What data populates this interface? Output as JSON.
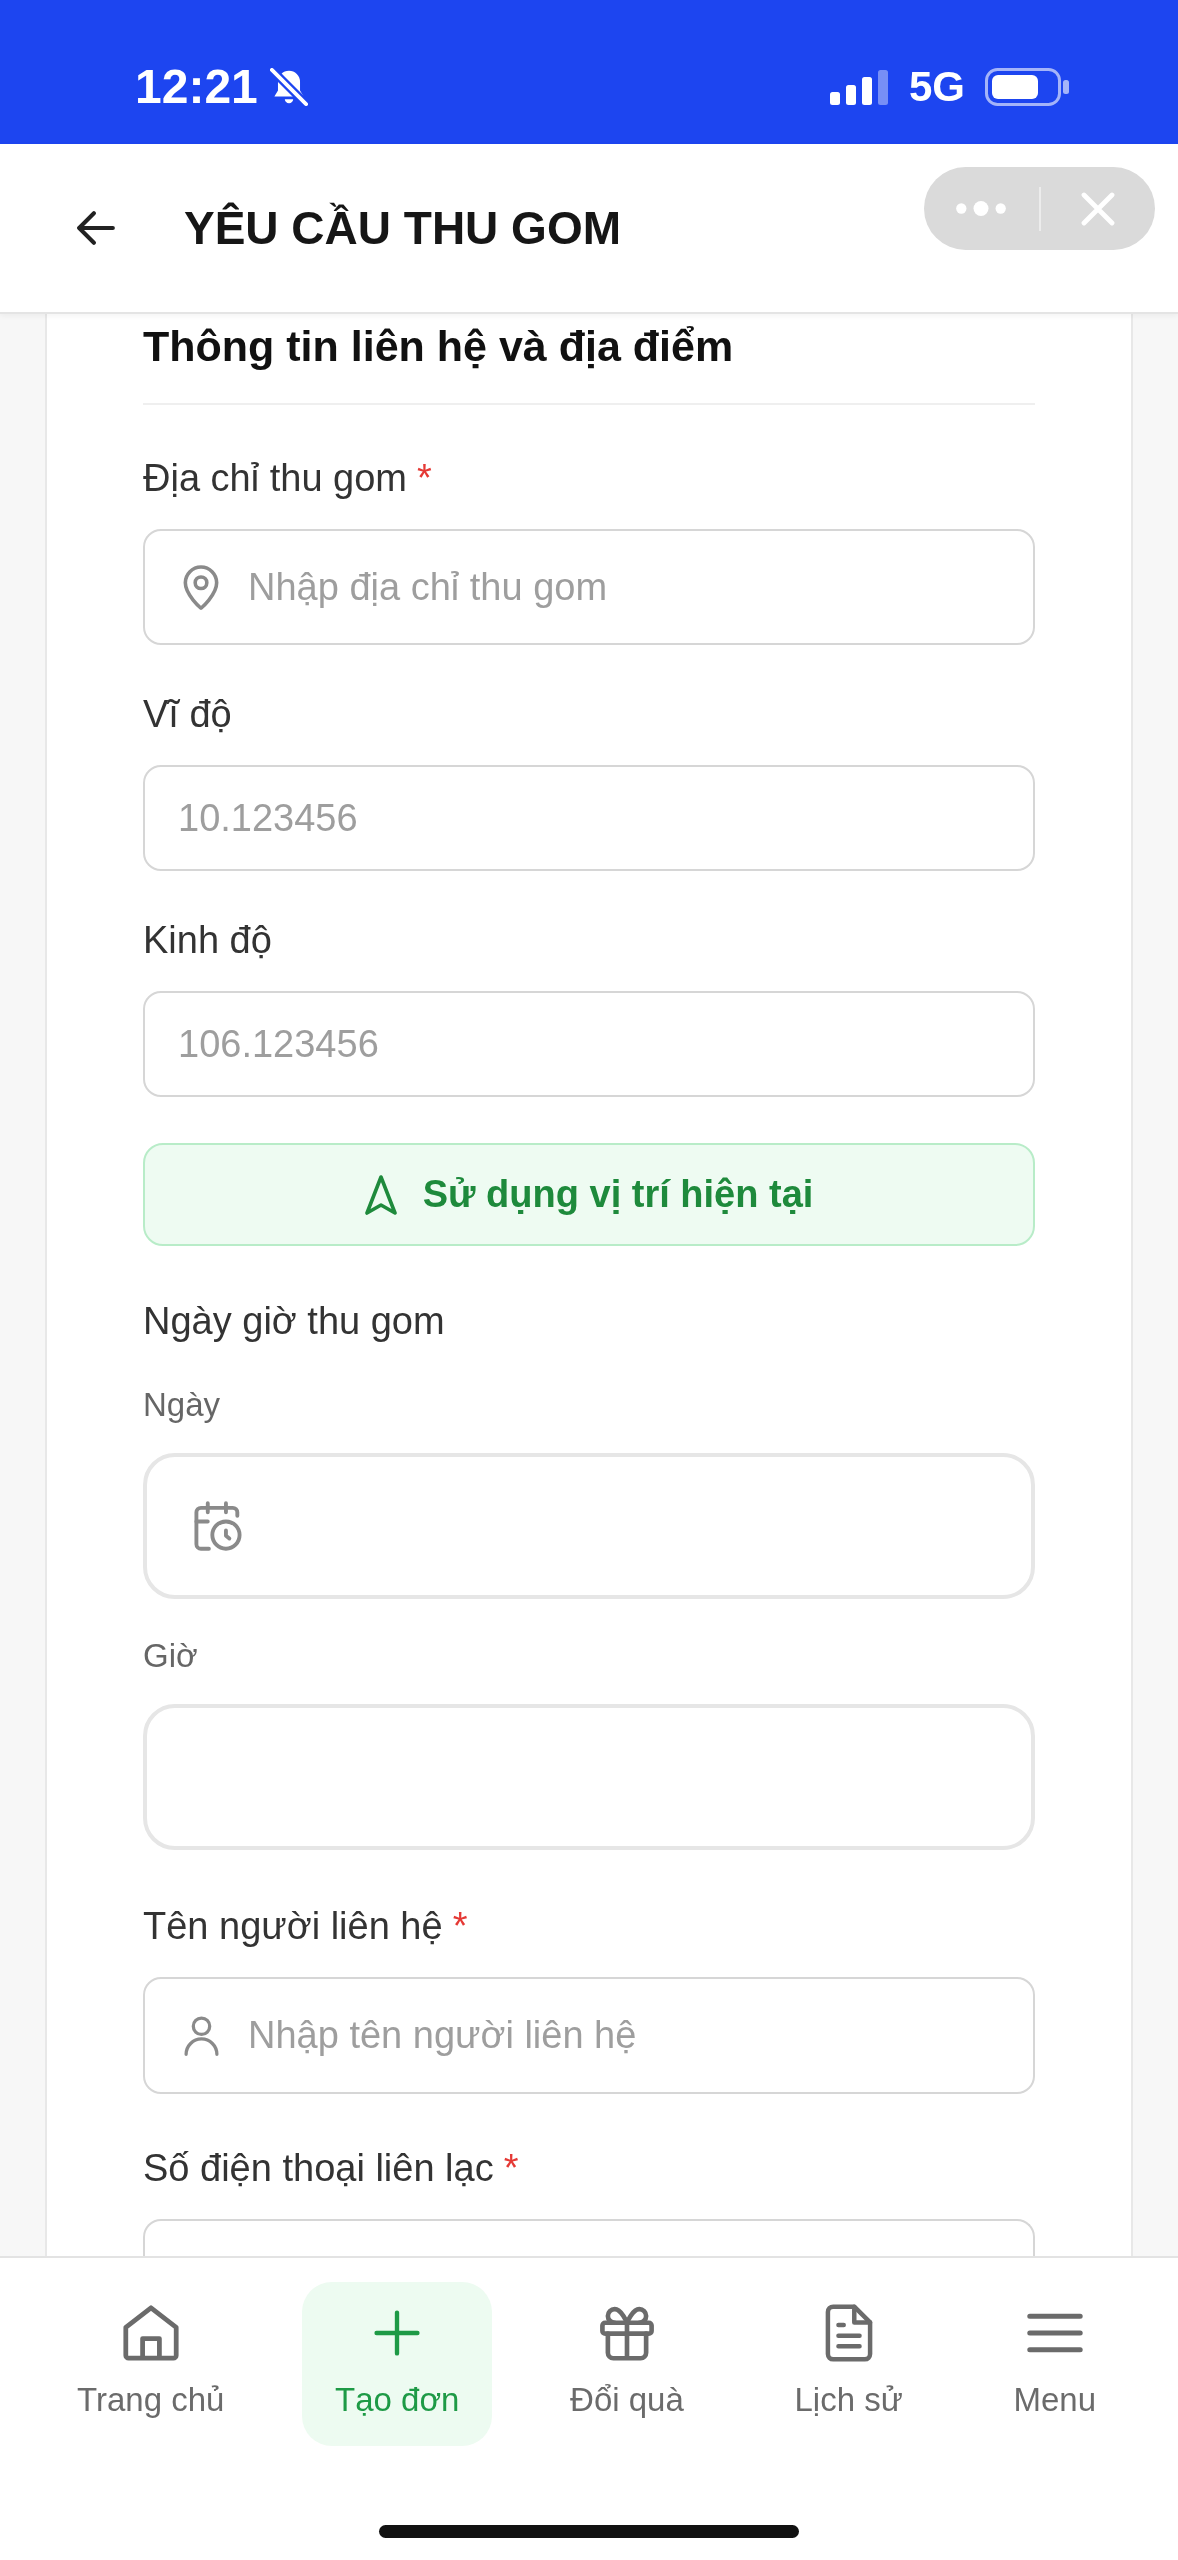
{
  "status_bar": {
    "time": "12:21",
    "silent": true,
    "network": "5G"
  },
  "header": {
    "title": "YÊU CẦU THU GOM"
  },
  "form": {
    "title": "Thông tin liên hệ và địa điểm",
    "items": [
      {
        "kind": "address",
        "label": "Địa chỉ thu gom",
        "required_mark": "*",
        "placeholder": "Nhập địa chỉ thu gom"
      },
      {
        "kind": "coordinate",
        "label": "Vĩ độ",
        "placeholder": "10.123456"
      },
      {
        "kind": "coordinate",
        "label": "Kinh độ",
        "placeholder": "106.123456"
      },
      {
        "kind": "action",
        "label": "Sử dụng vị trí hiện tại"
      },
      {
        "kind": "group",
        "label": "Ngày giờ thu gom"
      },
      {
        "kind": "date",
        "label": "Ngày"
      },
      {
        "kind": "time",
        "label": "Giờ"
      },
      {
        "kind": "name",
        "label": "Tên người liên hệ",
        "required_mark": "*",
        "placeholder": "Nhập tên người liên hệ"
      },
      {
        "kind": "phone",
        "label": "Số điện thoại liên lạc",
        "required_mark": "*"
      }
    ]
  },
  "bottom_nav": {
    "items": [
      {
        "kind": "home",
        "label": "Trang chủ",
        "selected": false
      },
      {
        "kind": "create",
        "label": "Tạo đơn",
        "selected": true
      },
      {
        "kind": "gift",
        "label": "Đổi quà",
        "selected": false
      },
      {
        "kind": "history",
        "label": "Lịch sử",
        "selected": false
      },
      {
        "kind": "menu",
        "label": "Menu",
        "selected": false
      }
    ]
  }
}
